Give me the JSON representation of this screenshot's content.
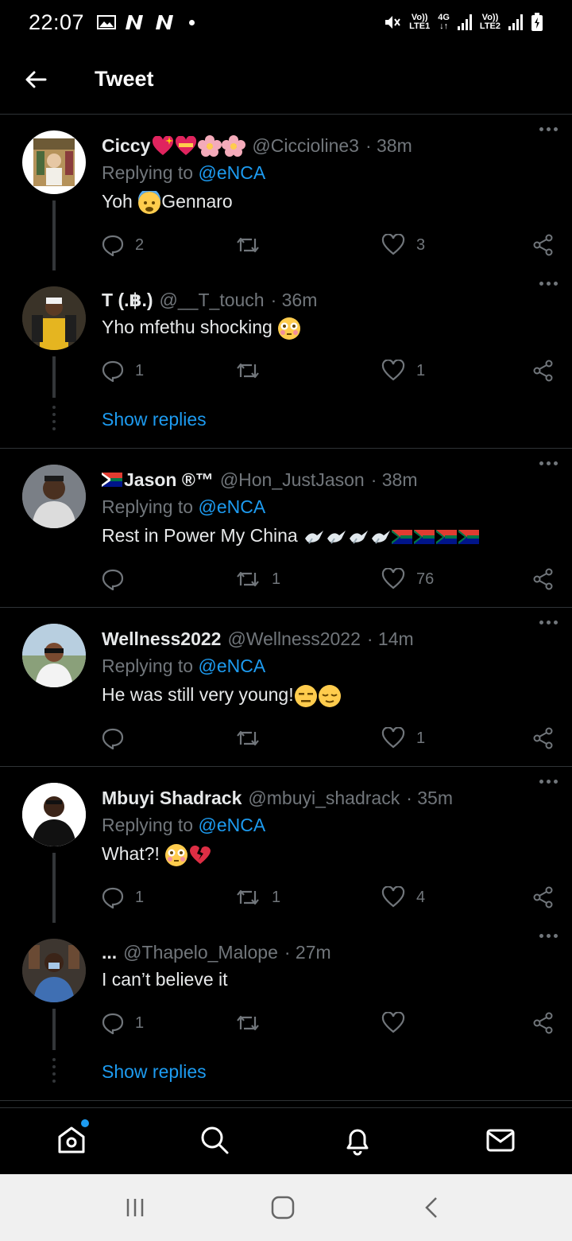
{
  "status_bar": {
    "time": "22:07",
    "network1_top": "Vo))",
    "network1_bottom": "LTE1",
    "network_gen": "4G",
    "network2_top": "Vo))",
    "network2_bottom": "LTE2"
  },
  "header": {
    "title": "Tweet"
  },
  "colors": {
    "background": "#000000",
    "accent": "#1d9bf0",
    "muted": "#71767b",
    "divider": "#2f3336"
  },
  "tweets": [
    {
      "display_name": "Ciccy",
      "handle": "@Ciccioline3",
      "time": "· 38m",
      "replying_prefix": "Replying to",
      "replying_to": "@eNCA",
      "text_before": "Yoh",
      "text_after": "Gennaro",
      "replies": "2",
      "retweets": "",
      "likes": "3"
    },
    {
      "display_name": "T (.฿.)",
      "handle": "@__T_touch",
      "time": "· 36m",
      "text": "Yho mfethu shocking",
      "replies": "1",
      "retweets": "",
      "likes": "1"
    },
    {
      "display_name": "Jason ®™",
      "handle": "@Hon_JustJason",
      "time": "· 38m",
      "replying_prefix": "Replying to",
      "replying_to": "@eNCA",
      "text": "Rest in Power My China",
      "replies": "",
      "retweets": "1",
      "likes": "76"
    },
    {
      "display_name": "Wellness2022",
      "handle": "@Wellness2022",
      "time": "· 14m",
      "replying_prefix": "Replying to",
      "replying_to": "@eNCA",
      "text": "He was still very young!",
      "replies": "",
      "retweets": "",
      "likes": "1"
    },
    {
      "display_name": "Mbuyi Shadrack",
      "handle": "@mbuyi_shadrack",
      "time": "· 35m",
      "replying_prefix": "Replying to",
      "replying_to": "@eNCA",
      "text": "What?!",
      "replies": "1",
      "retweets": "1",
      "likes": "4"
    },
    {
      "display_name": "...",
      "handle": "@Thapelo_Malope",
      "time": "· 27m",
      "text": "I can’t believe it",
      "replies": "1",
      "retweets": "",
      "likes": ""
    }
  ],
  "show_replies_label": "Show replies",
  "bottom_nav": {
    "items": [
      "home-icon",
      "search-icon",
      "bell-icon",
      "mail-icon"
    ]
  }
}
